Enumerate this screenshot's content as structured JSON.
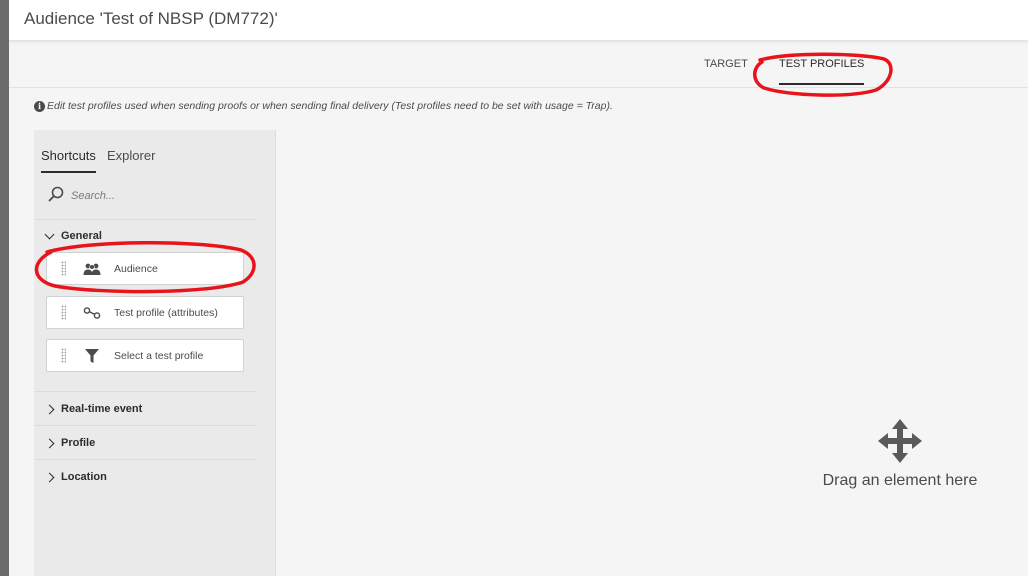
{
  "page": {
    "title": "Audience 'Test of NBSP (DM772)'"
  },
  "tabs": [
    {
      "label": "TARGET",
      "active": false
    },
    {
      "label": "TEST PROFILES",
      "active": true
    }
  ],
  "info_text": "Edit test profiles used when sending proofs or when sending final delivery (Test profiles need to be set with usage = Trap).",
  "palette": {
    "tabs": [
      {
        "label": "Shortcuts",
        "active": true
      },
      {
        "label": "Explorer",
        "active": false
      }
    ],
    "search_placeholder": "Search...",
    "groups": [
      {
        "label": "General",
        "expanded": true,
        "items": [
          {
            "label": "Audience",
            "icon": "audience-icon"
          },
          {
            "label": "Test profile (attributes)",
            "icon": "link-nodes-icon"
          },
          {
            "label": "Select a test profile",
            "icon": "filter-icon"
          }
        ]
      },
      {
        "label": "Real-time event",
        "expanded": false
      },
      {
        "label": "Profile",
        "expanded": false
      },
      {
        "label": "Location",
        "expanded": false
      }
    ]
  },
  "canvas": {
    "drop_hint": "Drag an element here",
    "icon": "move-arrows-icon"
  },
  "colors": {
    "annotation": "#e8141c",
    "accent_text": "#2c2c2c",
    "panel_bg": "#eaeaea"
  }
}
